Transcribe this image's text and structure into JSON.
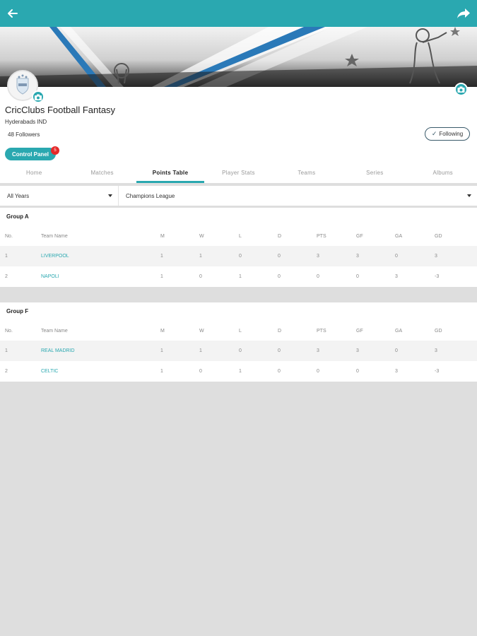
{
  "club": {
    "name": "CricClubs Football Fantasy",
    "location": "Hyderabads IND",
    "followers": "48 Followers",
    "following_label": "Following",
    "control_panel_label": "Control Panel",
    "notification_count": "5"
  },
  "tabs": [
    {
      "label": "Home",
      "active": false
    },
    {
      "label": "Matches",
      "active": false
    },
    {
      "label": "Points Table",
      "active": true
    },
    {
      "label": "Player Stats",
      "active": false
    },
    {
      "label": "Teams",
      "active": false
    },
    {
      "label": "Series",
      "active": false
    },
    {
      "label": "Albums",
      "active": false
    }
  ],
  "filters": {
    "year": "All Years",
    "series": "Champions League"
  },
  "columns": [
    "No.",
    "Team Name",
    "M",
    "W",
    "L",
    "D",
    "PTS",
    "GF",
    "GA",
    "GD"
  ],
  "groups": [
    {
      "title": "Group A",
      "rows": [
        {
          "no": "1",
          "team": "LIVERPOOL",
          "m": "1",
          "w": "1",
          "l": "0",
          "d": "0",
          "pts": "3",
          "gf": "3",
          "ga": "0",
          "gd": "3"
        },
        {
          "no": "2",
          "team": "NAPOLI",
          "m": "1",
          "w": "0",
          "l": "1",
          "d": "0",
          "pts": "0",
          "gf": "0",
          "ga": "3",
          "gd": "-3"
        }
      ]
    },
    {
      "title": "Group F",
      "rows": [
        {
          "no": "1",
          "team": "REAL MADRID",
          "m": "1",
          "w": "1",
          "l": "0",
          "d": "0",
          "pts": "3",
          "gf": "3",
          "ga": "0",
          "gd": "3"
        },
        {
          "no": "2",
          "team": "CELTIC",
          "m": "1",
          "w": "0",
          "l": "1",
          "d": "0",
          "pts": "0",
          "gf": "0",
          "ga": "3",
          "gd": "-3"
        }
      ]
    }
  ],
  "colors": {
    "accent": "#2aa8b0",
    "notification": "#e52929"
  },
  "icons": {
    "back": "arrow-left-icon",
    "share": "share-icon",
    "camera": "camera-icon"
  }
}
